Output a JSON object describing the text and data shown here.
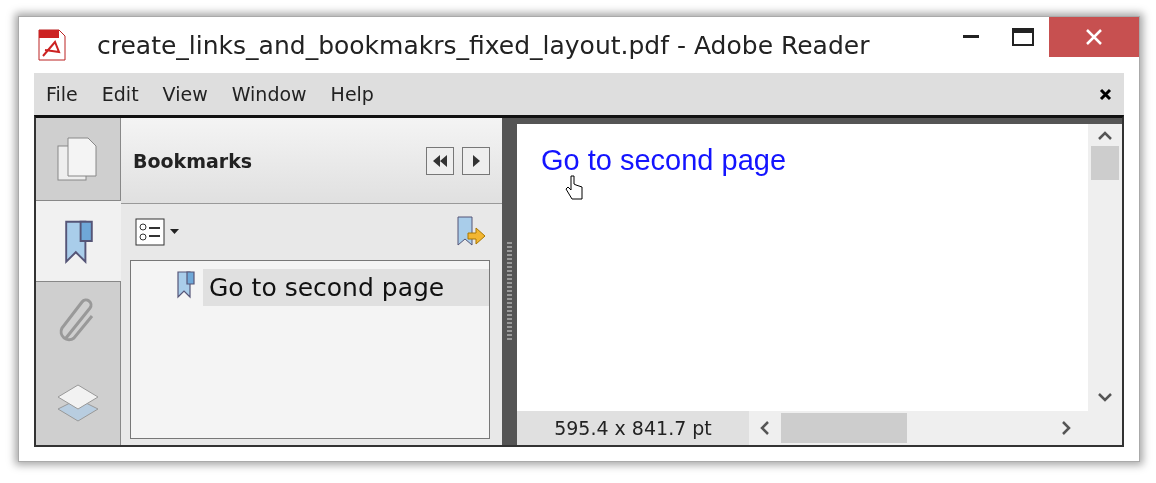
{
  "window": {
    "title": "create_links_and_bookmakrs_fixed_layout.pdf - Adobe Reader"
  },
  "menu": [
    "File",
    "Edit",
    "View",
    "Window",
    "Help"
  ],
  "side_tabs": [
    {
      "kind": "pages",
      "selected": false
    },
    {
      "kind": "bookmarks",
      "selected": true
    },
    {
      "kind": "attachments",
      "selected": false
    },
    {
      "kind": "layers",
      "selected": false
    }
  ],
  "panel": {
    "title": "Bookmarks",
    "bookmarks": [
      {
        "label": "Go to second page",
        "selected": true
      }
    ]
  },
  "document": {
    "link": "Go to second page"
  },
  "status_bar": {
    "page_size": "595.4 x 841.7 pt"
  }
}
